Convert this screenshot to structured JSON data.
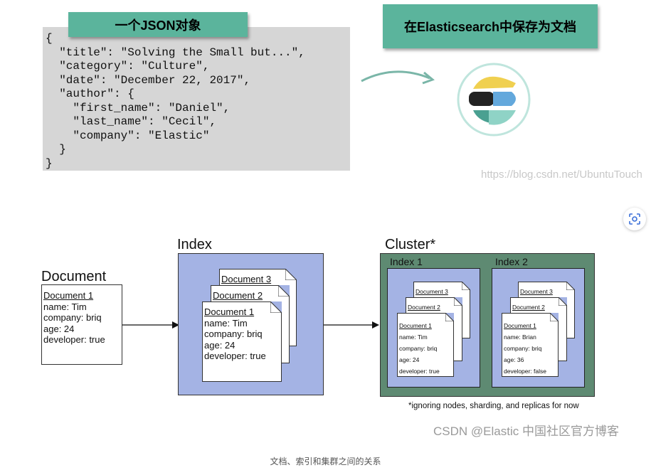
{
  "top": {
    "json_tag": "一个JSON对象",
    "es_tag": "在Elasticsearch中保存为文档",
    "json_lines": [
      "{",
      "  \"title\": \"Solving the Small but...\",",
      "  \"category\": \"Culture\",",
      "  \"date\": \"December 22, 2017\",",
      "  \"author\": {",
      "    \"first_name\": \"Daniel\",",
      "    \"last_name\": \"Cecil\",",
      "    \"company\": \"Elastic\"",
      "  }",
      "}"
    ],
    "watermark": "https://blog.csdn.net/UbuntuTouch",
    "logo_colors": {
      "yellow": "#f0d050",
      "black": "#222222",
      "blue": "#63a8dc",
      "teal": "#4aa091",
      "mint": "#8fd3c6",
      "ring": "#bfe5dd"
    }
  },
  "diagram": {
    "document_title": "Document",
    "index_title": "Index",
    "cluster_title": "Cluster*",
    "index1_title": "Index 1",
    "index2_title": "Index 2",
    "doc1_label": "Document 1",
    "doc2_label": "Document 2",
    "doc3_label": "Document 3",
    "tim": {
      "name": "name: Tim",
      "company": "company: briq",
      "age": "age: 24",
      "developer": "developer: true"
    },
    "brian": {
      "name": "name: Brian",
      "company": "company: briq",
      "age": "age: 36",
      "developer": "developer: false"
    },
    "note": "*ignoring nodes, sharding, and replicas for now",
    "colors": {
      "index_fill": "#a4b3e4",
      "cluster_fill": "#5e8a72",
      "tag_fill": "#5bb49c"
    }
  },
  "footer": {
    "watermark": "CSDN @Elastic 中国社区官方博客",
    "caption": "文档、索引和集群之间的关系"
  }
}
